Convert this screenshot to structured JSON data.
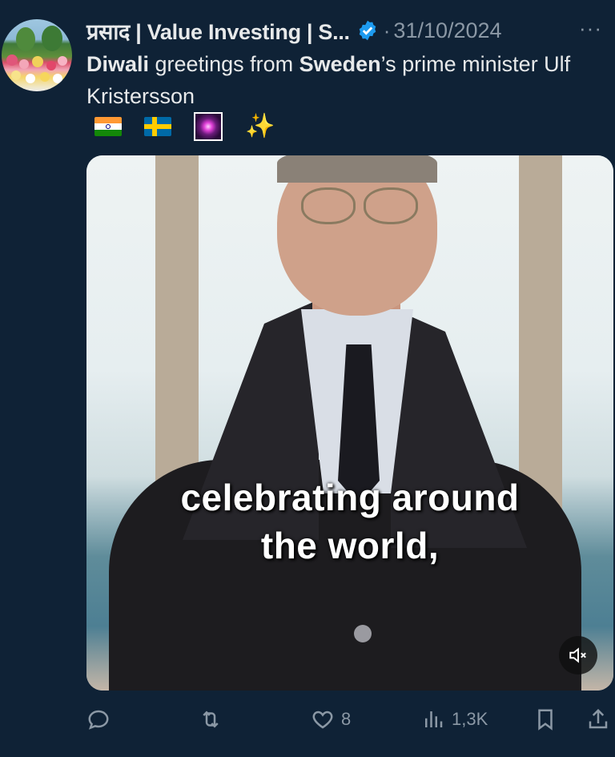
{
  "author": {
    "name": "प्रसाद | Value Investing | S...",
    "date": "31/10/2024",
    "more_label": "···",
    "avatar_icon": "tulip-field-avatar"
  },
  "tweet": {
    "segments": [
      {
        "text": "Diwali",
        "bold": true
      },
      {
        "text": " greetings from ",
        "bold": false
      },
      {
        "text": "Sweden",
        "bold": true
      },
      {
        "text": "’s prime minister Ulf Kristersson",
        "bold": false
      }
    ],
    "emojis": [
      "india-flag-icon",
      "sweden-flag-icon",
      "firework-icon",
      "sparkles-icon"
    ],
    "sparkles": "✨"
  },
  "media": {
    "caption_line1": "celebrating around",
    "caption_line2": "the world,",
    "mute_icon": "muted-speaker-icon"
  },
  "actions": {
    "reply_count": "",
    "retweet_count": "",
    "like_count": "8",
    "views_count": "1,3K"
  },
  "colors": {
    "background": "#0f2236",
    "text": "#e7e9ea",
    "muted": "#8b98a5",
    "verified": "#1d9bf0"
  }
}
